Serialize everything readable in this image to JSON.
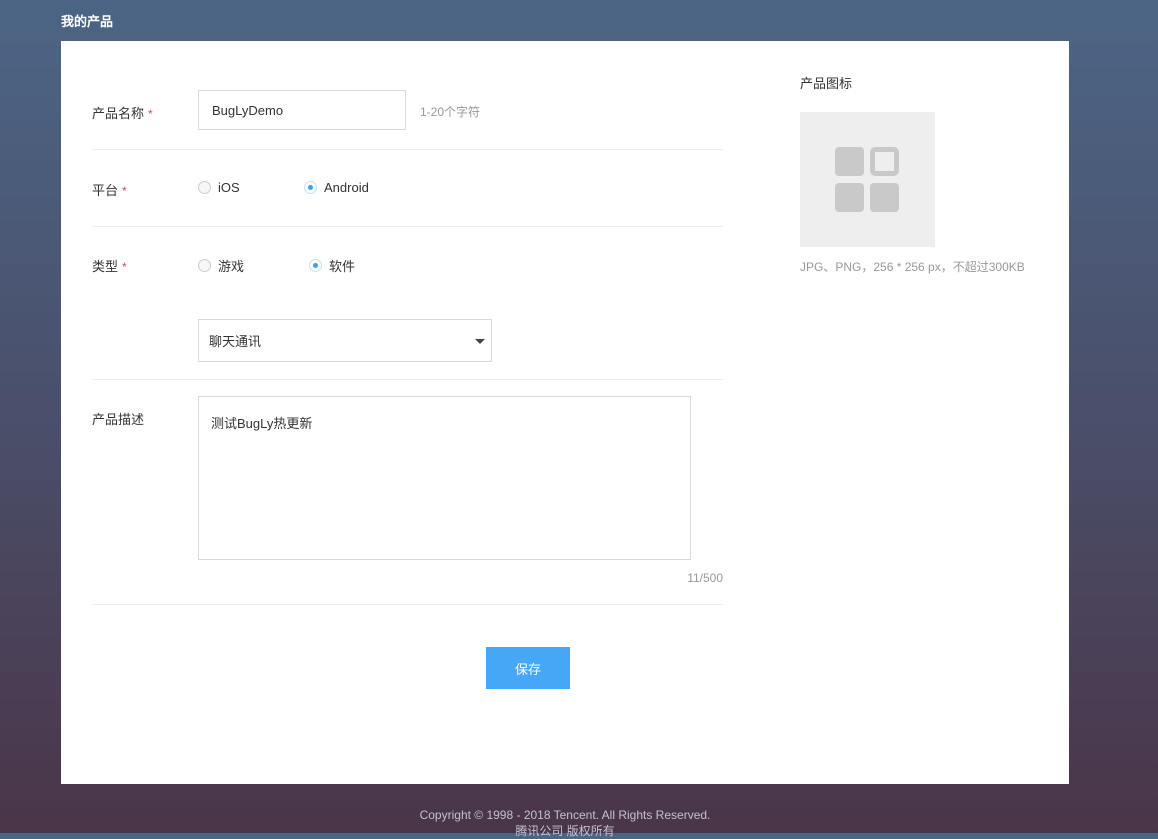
{
  "header": {
    "title": "我的产品"
  },
  "form": {
    "name": {
      "label": "产品名称",
      "required_mark": "*",
      "value": "BugLyDemo",
      "hint": "1-20个字符"
    },
    "platform": {
      "label": "平台",
      "required_mark": "*",
      "options": [
        "iOS",
        "Android"
      ],
      "selected": "Android"
    },
    "type": {
      "label": "类型",
      "required_mark": "*",
      "options": [
        "游戏",
        "软件"
      ],
      "selected": "软件"
    },
    "category": {
      "selected": "聊天通讯"
    },
    "description": {
      "label": "产品描述",
      "value": "测试BugLy热更新",
      "counter": "11/500"
    },
    "save_label": "保存"
  },
  "icon_panel": {
    "title": "产品图标",
    "hint": "JPG、PNG，256 * 256 px，不超过300KB",
    "icon": "app-grid-icon"
  },
  "footer": {
    "copyright": "Copyright © 1998 - 2018 Tencent. All Rights Reserved.",
    "rights": "腾讯公司 版权所有"
  },
  "colors": {
    "accent": "#45a7f5",
    "required": "#e9405b",
    "radio_dot": "#3d9eec",
    "card_bg": "#ffffff",
    "page_bg_top": "#4c6585",
    "page_bg_bottom": "#4a3548"
  }
}
